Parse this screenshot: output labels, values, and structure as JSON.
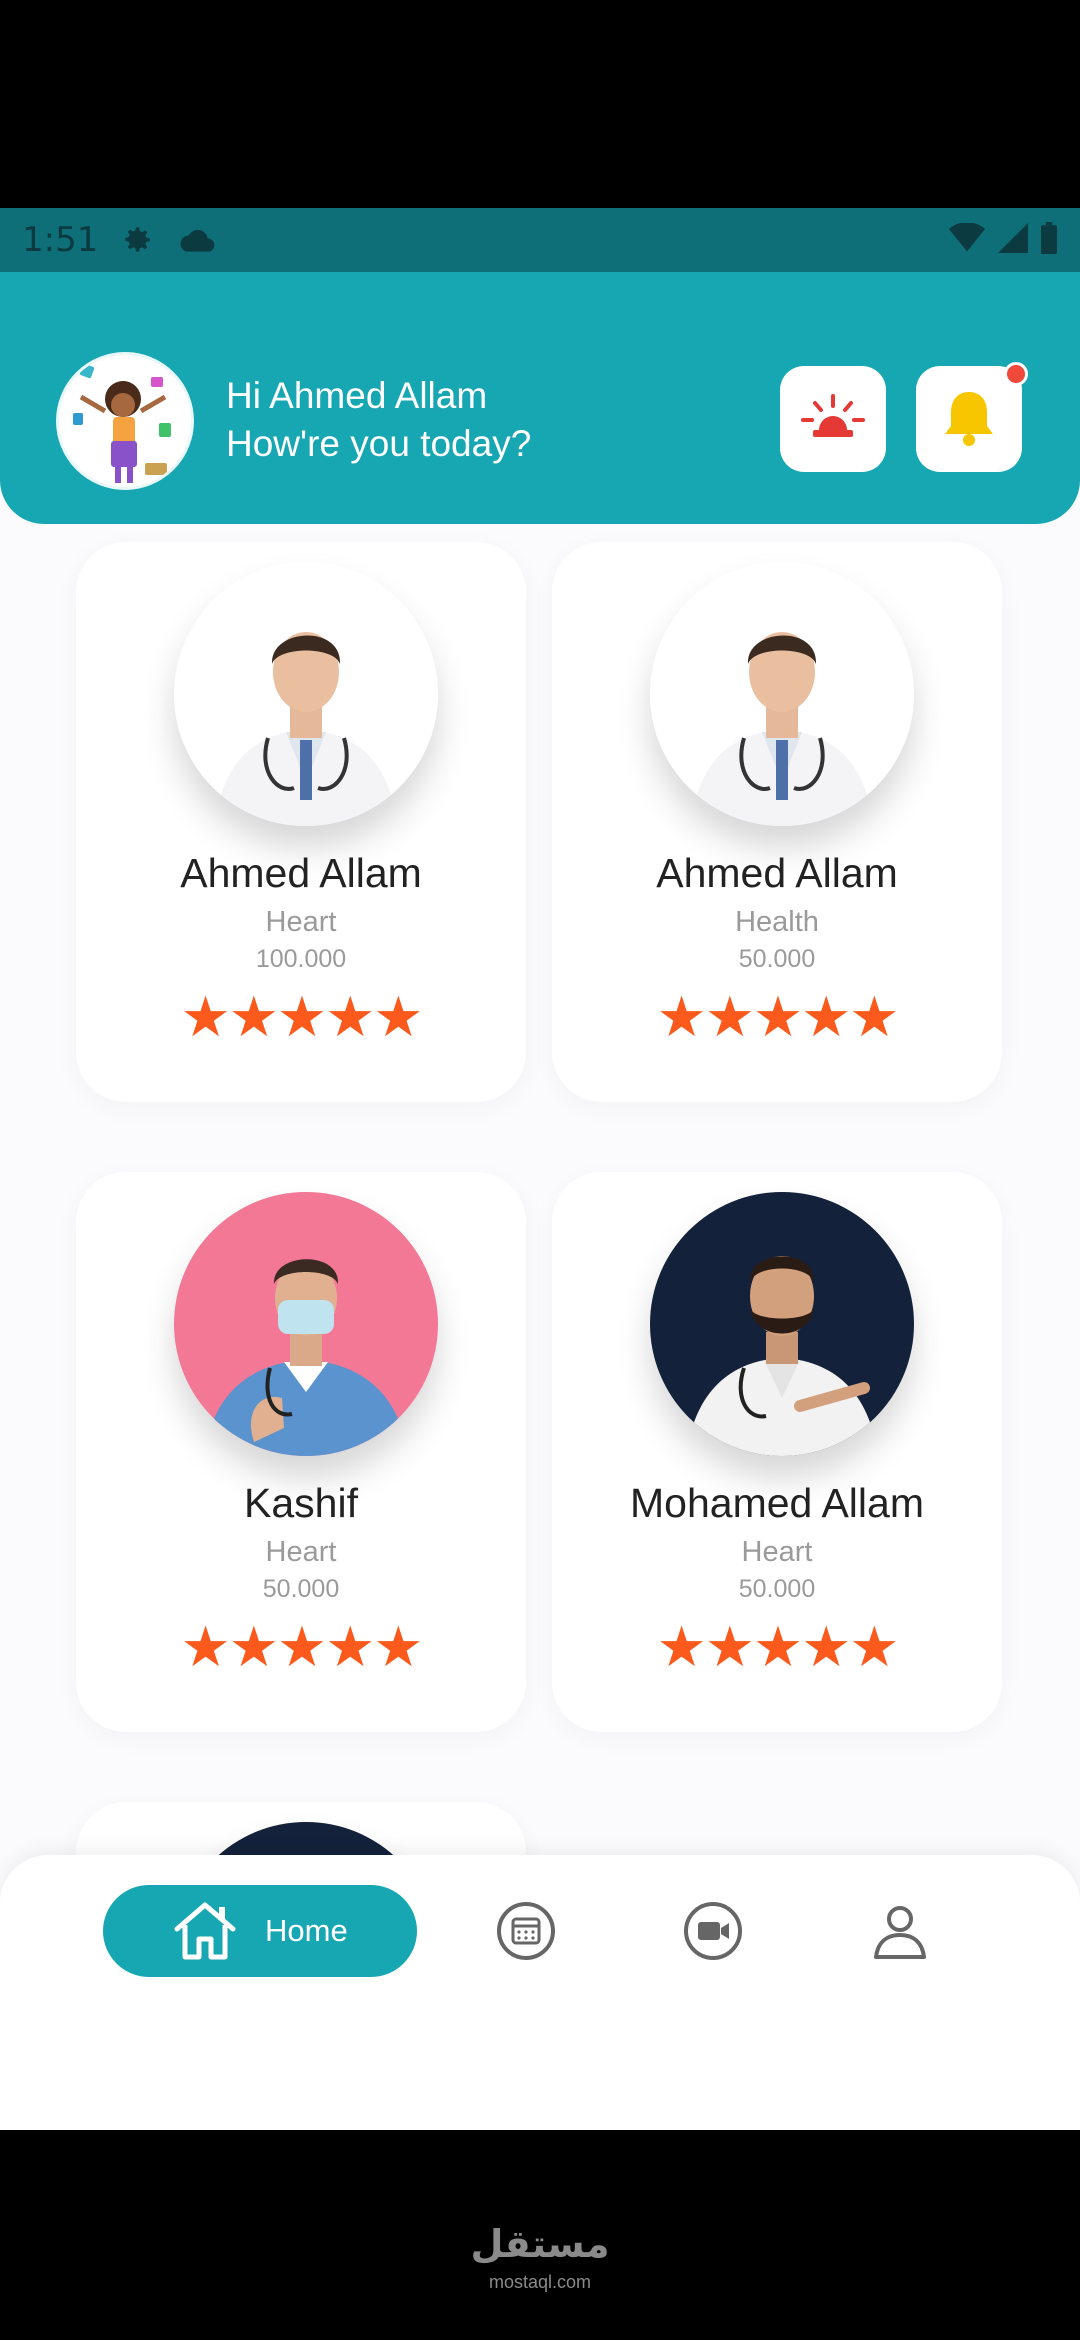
{
  "status_bar": {
    "time": "1:51"
  },
  "header": {
    "greeting": "Hi Ahmed Allam",
    "subgreeting": "How're you today?"
  },
  "doctors": [
    {
      "name": "Ahmed Allam",
      "specialty": "Heart",
      "price": "100.000",
      "rating": 5
    },
    {
      "name": "Ahmed Allam",
      "specialty": "Health",
      "price": "50.000",
      "rating": 5
    },
    {
      "name": "Kashif",
      "specialty": "Heart",
      "price": "50.000",
      "rating": 5
    },
    {
      "name": "Mohamed Allam",
      "specialty": "Heart",
      "price": "50.000",
      "rating": 5
    }
  ],
  "bottom_nav": {
    "home_label": "Home",
    "items": [
      "home-icon",
      "calendar-icon",
      "video-call-icon",
      "profile-icon"
    ]
  },
  "watermark": {
    "arabic": "مستقل",
    "latin": "mostaql.com"
  },
  "colors": {
    "primary": "#17a7b3",
    "star": "#fb5a1c",
    "alert": "#e53935",
    "bell": "#f7c600"
  }
}
